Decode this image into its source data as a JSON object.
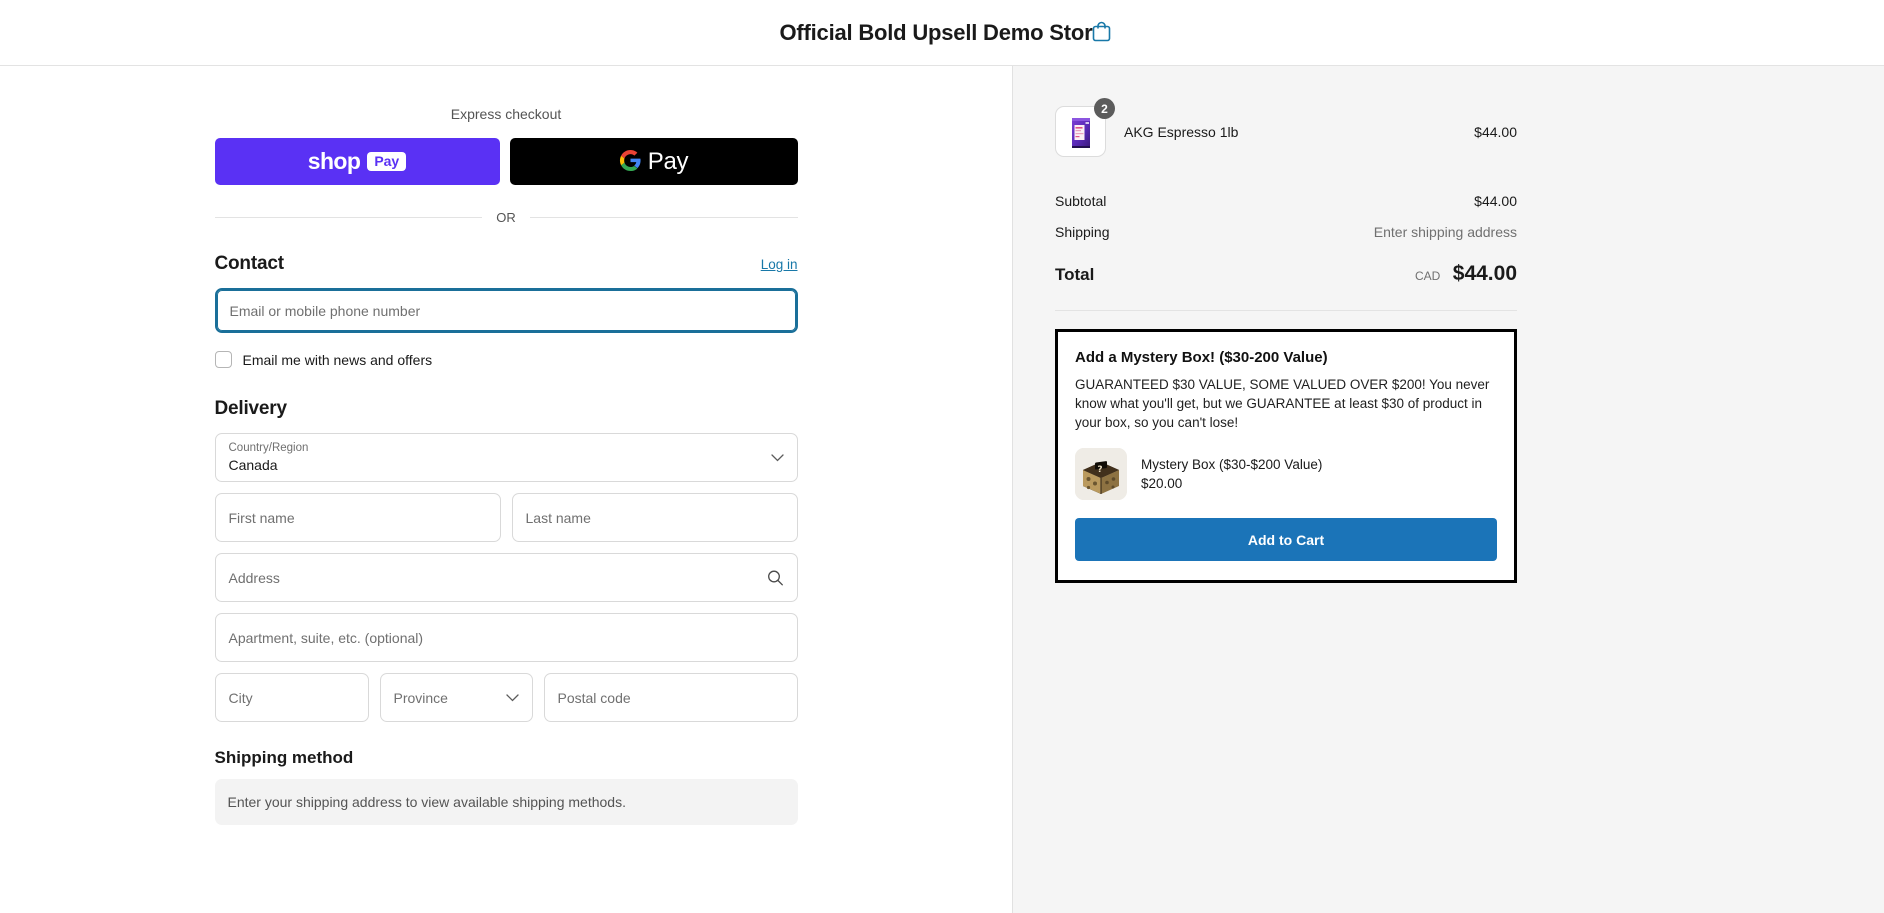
{
  "header": {
    "store_title": "Official Bold Upsell Demo Store",
    "cart_icon": "shopping-bag-icon"
  },
  "express": {
    "label": "Express checkout",
    "shop_pay": {
      "word": "shop",
      "chip": "Pay"
    },
    "google_pay": {
      "word": "Pay",
      "icon": "google-g-icon"
    },
    "divider": "OR"
  },
  "contact": {
    "title": "Contact",
    "login_label": "Log in",
    "email_placeholder": "Email or mobile phone number",
    "email_value": "",
    "newsletter_label": "Email me with news and offers",
    "newsletter_checked": false
  },
  "delivery": {
    "title": "Delivery",
    "country": {
      "label": "Country/Region",
      "value": "Canada",
      "icon": "chevron-down-icon"
    },
    "first_name_placeholder": "First name",
    "last_name_placeholder": "Last name",
    "address_placeholder": "Address",
    "address_icon": "search-icon",
    "apartment_placeholder": "Apartment, suite, etc. (optional)",
    "city_placeholder": "City",
    "province_placeholder": "Province",
    "province_icon": "chevron-down-icon",
    "postal_placeholder": "Postal code"
  },
  "shipping_method": {
    "title": "Shipping method",
    "empty_message": "Enter your shipping address to view available shipping methods."
  },
  "summary": {
    "items": [
      {
        "name": "AKG Espresso 1lb",
        "price": "$44.00",
        "quantity": "2",
        "thumb": "coffee-bag-purple"
      }
    ],
    "subtotal_label": "Subtotal",
    "subtotal_value": "$44.00",
    "shipping_label": "Shipping",
    "shipping_value": "Enter shipping address",
    "total_label": "Total",
    "total_currency": "CAD",
    "total_value": "$44.00"
  },
  "offer": {
    "title": "Add a Mystery Box! ($30-200 Value)",
    "description": "GUARANTEED $30 VALUE, SOME VALUED OVER $200! You never know what you'll get, but we GUARANTEE at least $30 of product in your box, so you can't lose!",
    "product_name": "Mystery Box ($30-$200 Value)",
    "product_price": "$20.00",
    "product_thumb": "mystery-box-icon",
    "add_to_cart_label": "Add to Cart"
  },
  "colors": {
    "shop_pay_purple": "#5a31f4",
    "google_pay_black": "#000000",
    "accent_link": "#1878a8",
    "focus_border": "#1a6f99",
    "add_to_cart_blue": "#1b74b8",
    "offer_border": "#000000",
    "summary_bg": "#f5f5f5"
  }
}
